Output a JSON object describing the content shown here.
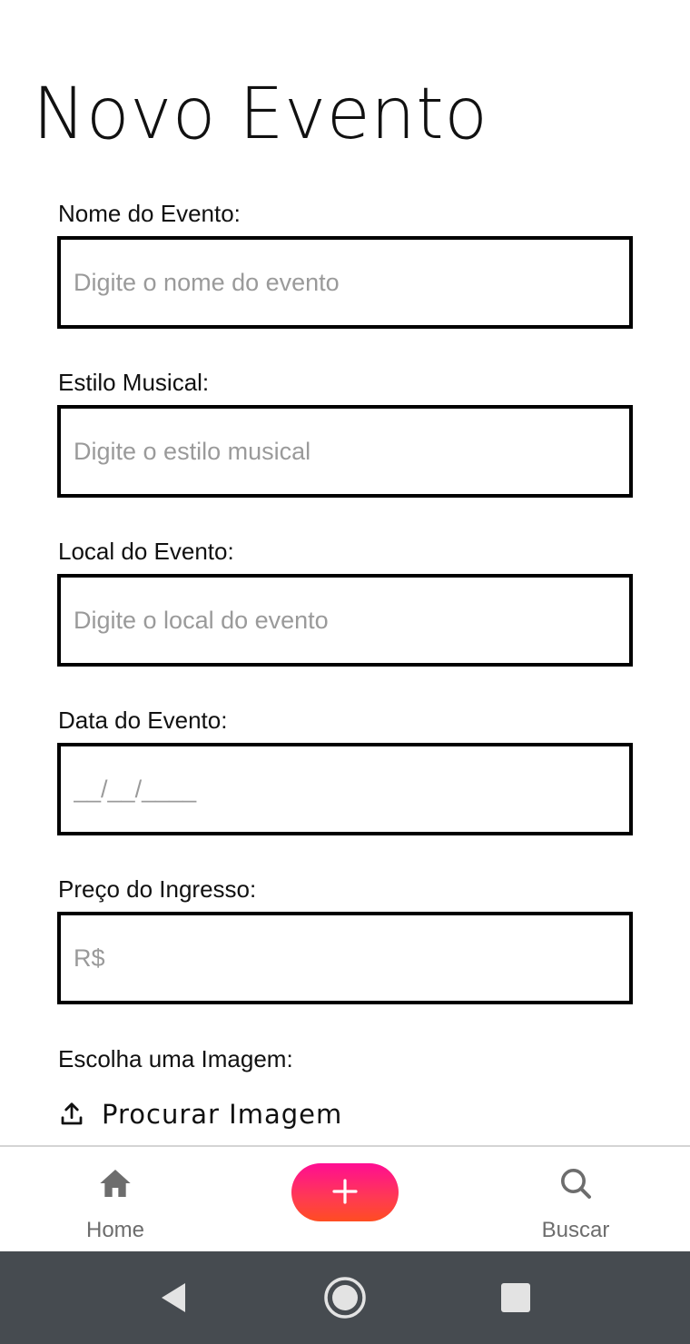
{
  "page": {
    "title": "Novo Evento"
  },
  "form": {
    "fields": [
      {
        "label": "Nome do Evento:",
        "placeholder": "Digite o nome do evento",
        "value": ""
      },
      {
        "label": "Estilo Musical:",
        "placeholder": "Digite o estilo musical",
        "value": ""
      },
      {
        "label": "Local do Evento:",
        "placeholder": "Digite o local do evento",
        "value": ""
      },
      {
        "label": "Data do Evento:",
        "placeholder": "__/__/____",
        "value": ""
      },
      {
        "label": "Preço do Ingresso:",
        "placeholder": "R$",
        "value": ""
      }
    ],
    "image": {
      "label": "Escolha uma Imagem:",
      "button_label": "Procurar Imagem",
      "icon": "upload-icon"
    }
  },
  "tab_bar": {
    "home": {
      "label": "Home",
      "icon": "home-icon"
    },
    "add": {
      "label": "+",
      "icon": "plus-icon"
    },
    "search": {
      "label": "Buscar",
      "icon": "search-icon"
    },
    "accent_gradient": [
      "#ff0d93",
      "#ff4d22"
    ],
    "inactive_color": "#6d6d6d"
  },
  "system_nav": {
    "background": "#464b50",
    "buttons": [
      "back-icon",
      "home-circle-icon",
      "recents-icon"
    ]
  }
}
